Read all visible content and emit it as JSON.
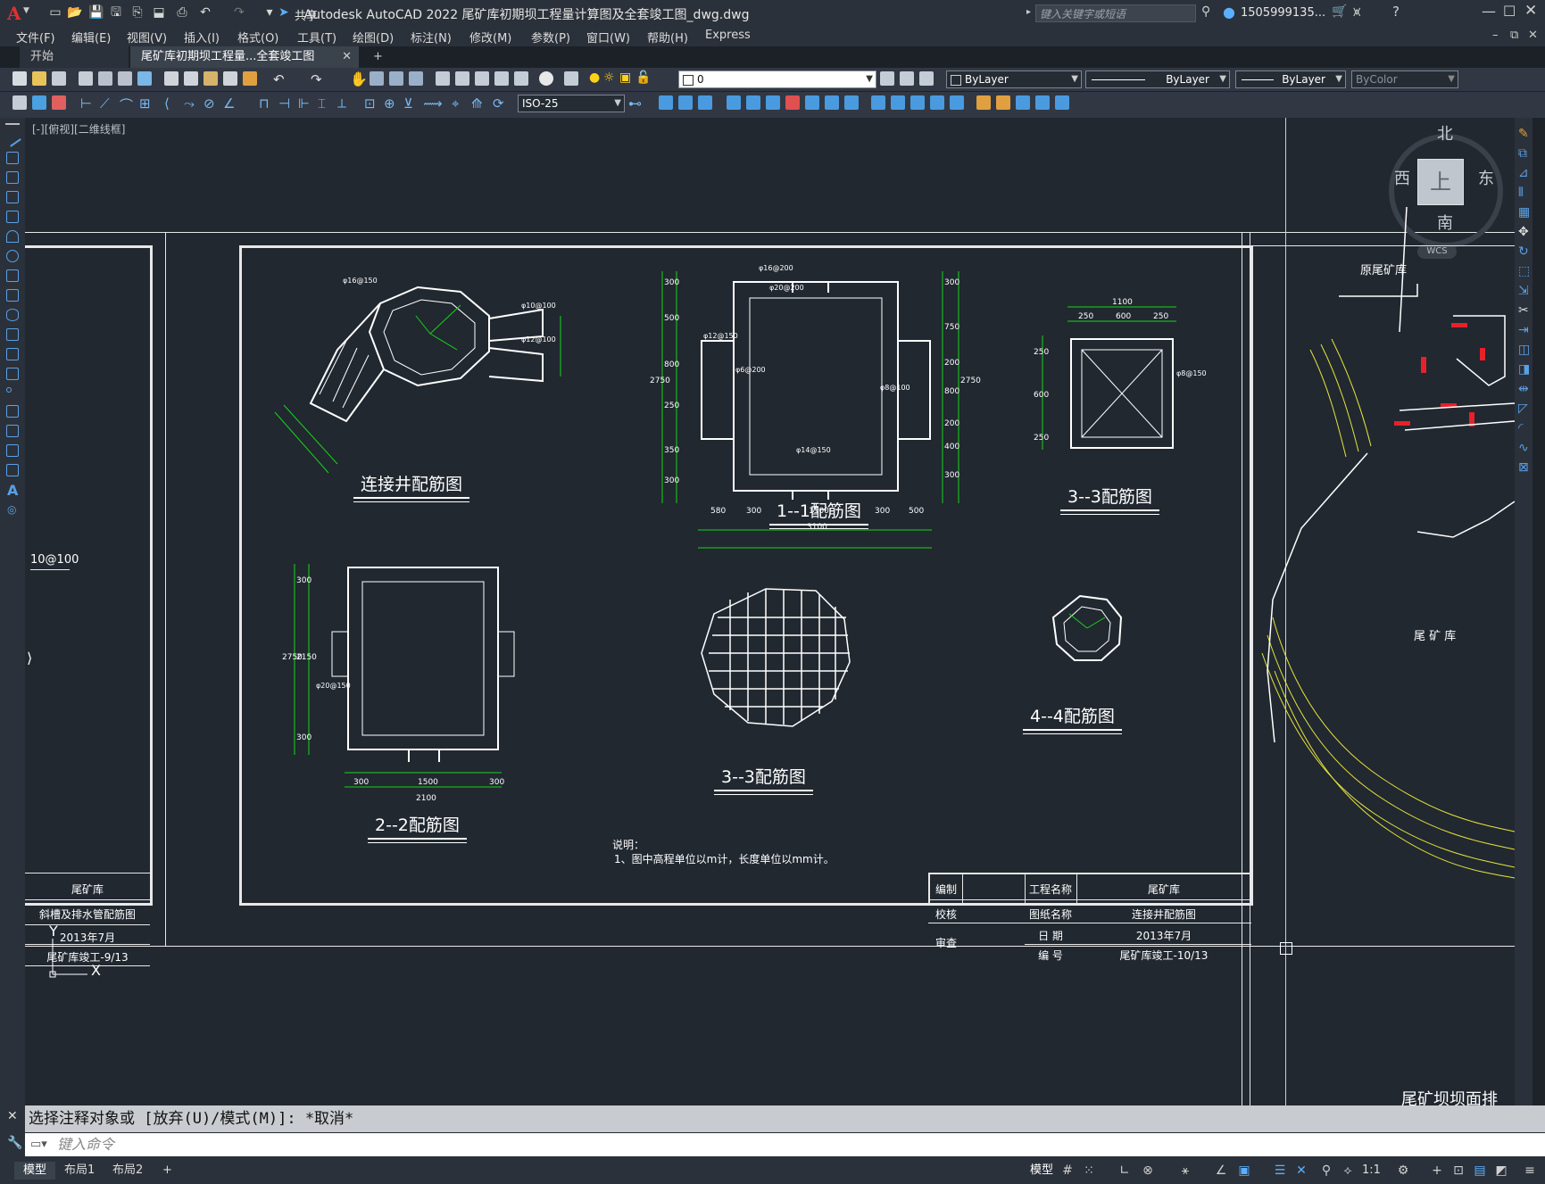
{
  "app": {
    "logo": "A",
    "title": "Autodesk AutoCAD 2022    尾矿库初期坝工程量计算图及全套竣工图_dwg.dwg",
    "share_label": "共享",
    "search_placeholder": "键入关键字或短语",
    "user": "1505999135...",
    "help": "?"
  },
  "menu": [
    "文件(F)",
    "编辑(E)",
    "视图(V)",
    "插入(I)",
    "格式(O)",
    "工具(T)",
    "绘图(D)",
    "标注(N)",
    "修改(M)",
    "参数(P)",
    "窗口(W)",
    "帮助(H)",
    "Express"
  ],
  "tabs": {
    "start": "开始",
    "active": "尾矿库初期坝工程量...全套竣工图_dwg*",
    "add": "+"
  },
  "toolbar": {
    "layer_value": "0",
    "color_value": "ByLayer",
    "linetype_value": "ByLayer",
    "lineweight_value": "ByLayer",
    "plotstyle_value": "ByColor",
    "dimstyle_value": "ISO-25"
  },
  "viewport": {
    "label": "[-][俯视][二维线框]",
    "viewcube": {
      "north": "北",
      "south": "南",
      "east": "东",
      "west": "西",
      "top": "上",
      "wcs": "WCS"
    }
  },
  "drawing": {
    "left_partial_label": "10@100",
    "left_titleblock": [
      "尾矿库",
      "斜槽及排水管配筋图",
      "2013年7月",
      "尾矿库竣工-9/13"
    ],
    "titles": {
      "t1": "连接井配筋图",
      "t2": "1--1配筋图",
      "t3": "3--3配筋图",
      "t4": "2--2配筋图",
      "t5": "3--3配筋图",
      "t6": "4--4配筋图"
    },
    "section1_dims": [
      "580",
      "300",
      "1500",
      "300",
      "500",
      "3100"
    ],
    "section1_vdims": [
      "300",
      "500",
      "800",
      "250",
      "350",
      "300",
      "2750"
    ],
    "section1_rdims": [
      "300",
      "750",
      "200",
      "800",
      "200",
      "400",
      "300",
      "2750"
    ],
    "section3_dims": [
      "1100",
      "250",
      "600",
      "250"
    ],
    "section3_vdims": [
      "250",
      "600",
      "250"
    ],
    "section2_dims": [
      "300",
      "1500",
      "300",
      "2100"
    ],
    "section2_vdims": [
      "300",
      "2150",
      "300",
      "2750"
    ],
    "rebar_labels": [
      "φ16@150",
      "φ10@100",
      "φ12@100",
      "φ16@200",
      "φ20@200",
      "φ12@150",
      "φ8@150",
      "φ14@150",
      "φ20@150",
      "φ6@200",
      "φ8@100"
    ],
    "note_title": "说明：",
    "note_text": "1、图中高程单位以m计，长度单位以mm计。",
    "titleblock": {
      "row1": [
        "编制",
        "工程名称",
        "尾矿库"
      ],
      "row2": [
        "校核",
        "图纸名称",
        "连接井配筋图"
      ],
      "row3": [
        "审查",
        "日    期",
        "2013年7月"
      ],
      "row4": [
        "",
        "编    号",
        "尾矿库竣工-10/13"
      ]
    },
    "right_sheet": {
      "label1": "原尾矿库",
      "label2": "尾 矿 库",
      "bottom_title": "尾矿坝坝面排"
    }
  },
  "command": {
    "history": "选择注释对象或 [放弃(U)/模式(M)]: *取消*",
    "placeholder": "键入命令"
  },
  "status": {
    "layouts": [
      "模型",
      "布局1",
      "布局2"
    ],
    "model": "模型",
    "scale": "1:1"
  },
  "colors": {
    "accent_green": "#19d419",
    "canvas_bg": "#212830",
    "logo_red": "#e0302f"
  }
}
